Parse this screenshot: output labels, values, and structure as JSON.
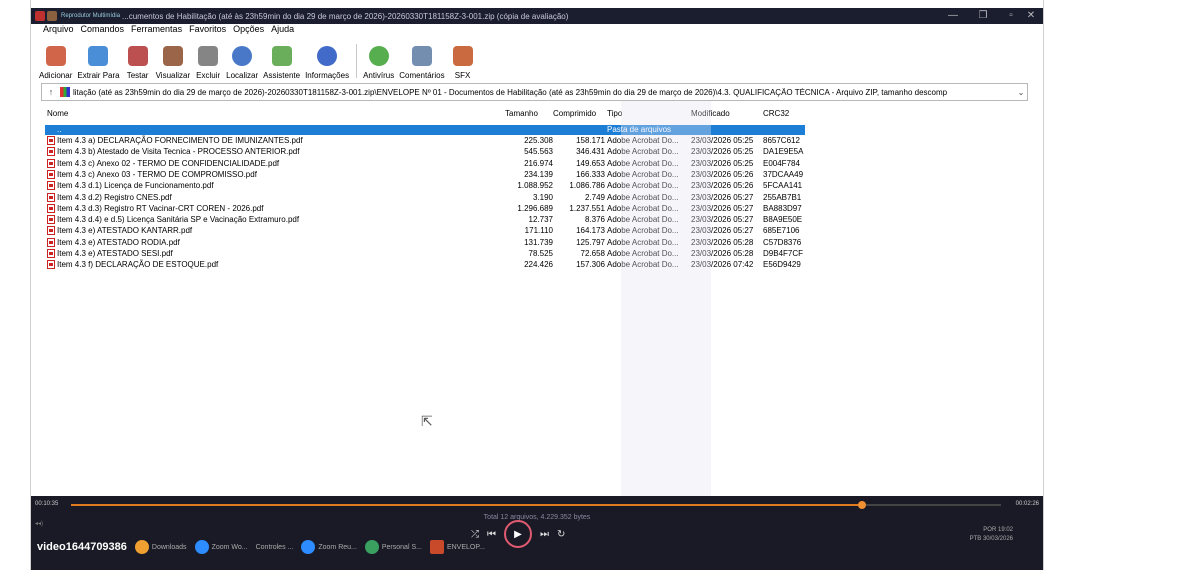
{
  "window": {
    "player_label": "Reprodutor Multimídia",
    "title": "...cumentos de Habilitação (até às 23h59min do dia 29 de março de 2026)-20260330T181158Z-3-001.zip (cópia de avaliação)"
  },
  "menu": [
    "Arquivo",
    "Comandos",
    "Ferramentas",
    "Favoritos",
    "Opções",
    "Ajuda"
  ],
  "toolbar": [
    {
      "label": "Adicionar",
      "icon": "add-archive-icon",
      "color": "#c84a2a"
    },
    {
      "label": "Extrair Para",
      "icon": "extract-icon",
      "color": "#2a7ad0"
    },
    {
      "label": "Testar",
      "icon": "test-icon",
      "color": "#b03030"
    },
    {
      "label": "Visualizar",
      "icon": "view-icon",
      "color": "#8a4a2a"
    },
    {
      "label": "Excluir",
      "icon": "delete-icon",
      "color": "#707070"
    },
    {
      "label": "Localizar",
      "icon": "find-icon",
      "color": "#2a60c0"
    },
    {
      "label": "Assistente",
      "icon": "wizard-icon",
      "color": "#50a040"
    },
    {
      "label": "Informações",
      "icon": "info-icon",
      "color": "#2050c0"
    },
    {
      "label": "Antivírus",
      "icon": "antivirus-icon",
      "color": "#3aa030"
    },
    {
      "label": "Comentários",
      "icon": "comment-icon",
      "color": "#5a7aa0"
    },
    {
      "label": "SFX",
      "icon": "sfx-icon",
      "color": "#c05020"
    }
  ],
  "address": {
    "path": "litação (até as 23h59min do dia 29 de março de 2026)-20260330T181158Z-3-001.zip\\ENVELOPE Nº 01 - Documentos de Habilitação (até as 23h59min do dia 29 de março de 2026)\\4.3. QUALIFICAÇÃO TÉCNICA - Arquivo ZIP, tamanho descomp"
  },
  "columns": {
    "name": "Nome",
    "size": "Tamanho",
    "packed": "Comprimido",
    "type": "Tipo",
    "modified": "Modificado",
    "crc": "CRC32"
  },
  "parent_row": {
    "name": "..",
    "type": "Pasta de arquivos"
  },
  "files": [
    {
      "name": "Item 4.3 a) DECLARAÇÃO FORNECIMENTO DE IMUNIZANTES.pdf",
      "size": "225.308",
      "packed": "158.171",
      "type": "Adobe Acrobat Do...",
      "modified": "23/03/2026 05:25",
      "crc": "8657C612"
    },
    {
      "name": "Item 4.3 b) Atestado de Visita Tecnica - PROCESSO ANTERIOR.pdf",
      "size": "545.563",
      "packed": "346.431",
      "type": "Adobe Acrobat Do...",
      "modified": "23/03/2026 05:25",
      "crc": "DA1E9E5A"
    },
    {
      "name": "Item 4.3 c) Anexo 02 - TERMO DE CONFIDENCIALIDADE.pdf",
      "size": "216.974",
      "packed": "149.653",
      "type": "Adobe Acrobat Do...",
      "modified": "23/03/2026 05:25",
      "crc": "E004F784"
    },
    {
      "name": "Item 4.3 c) Anexo 03 - TERMO DE COMPROMISSO.pdf",
      "size": "234.139",
      "packed": "166.333",
      "type": "Adobe Acrobat Do...",
      "modified": "23/03/2026 05:26",
      "crc": "37DCAA49"
    },
    {
      "name": "Item 4.3 d.1) Licença de Funcionamento.pdf",
      "size": "1.088.952",
      "packed": "1.086.786",
      "type": "Adobe Acrobat Do...",
      "modified": "23/03/2026 05:26",
      "crc": "5FCAA141"
    },
    {
      "name": "Item 4.3 d.2) Registro CNES.pdf",
      "size": "3.190",
      "packed": "2.749",
      "type": "Adobe Acrobat Do...",
      "modified": "23/03/2026 05:27",
      "crc": "255AB7B1"
    },
    {
      "name": "Item 4.3 d.3) Registro RT Vacinar-CRT COREN - 2026.pdf",
      "size": "1.296.689",
      "packed": "1.237.551",
      "type": "Adobe Acrobat Do...",
      "modified": "23/03/2026 05:27",
      "crc": "BA883D97"
    },
    {
      "name": "Item 4.3 d.4) e d.5) Licença Sanitária SP e Vacinação Extramuro.pdf",
      "size": "12.737",
      "packed": "8.376",
      "type": "Adobe Acrobat Do...",
      "modified": "23/03/2026 05:27",
      "crc": "B8A9E50E"
    },
    {
      "name": "Item 4.3 e) ATESTADO KANTARR.pdf",
      "size": "171.110",
      "packed": "164.173",
      "type": "Adobe Acrobat Do...",
      "modified": "23/03/2026 05:27",
      "crc": "685E7106"
    },
    {
      "name": "Item 4.3 e) ATESTADO RODIA.pdf",
      "size": "131.739",
      "packed": "125.797",
      "type": "Adobe Acrobat Do...",
      "modified": "23/03/2026 05:28",
      "crc": "C57D8376"
    },
    {
      "name": "Item 4.3 e) ATESTADO SESI.pdf",
      "size": "78.525",
      "packed": "72.658",
      "type": "Adobe Acrobat Do...",
      "modified": "23/03/2026 05:28",
      "crc": "D9B4F7CF"
    },
    {
      "name": "Item 4.3 f) DECLARAÇÃO DE ESTOQUE.pdf",
      "size": "224.426",
      "packed": "157.306",
      "type": "Adobe Acrobat Do...",
      "modified": "23/03/2026 07:42",
      "crc": "E56D9429"
    }
  ],
  "status": "Total 12 arquivos, 4.229.352 bytes",
  "player": {
    "elapsed": "00:10:35",
    "total": "00:02:26",
    "progress": 0.85
  },
  "taskbar": {
    "video_name": "video1644709386",
    "apps": [
      "Downloads",
      "Zoom Wo...",
      "Controles ...",
      "Zoom Reu...",
      "Personal S...",
      "ENVELOP..."
    ],
    "lang": "POR",
    "lang2": "PTB",
    "time": "19:02",
    "date": "30/03/2026"
  },
  "colors": {
    "selection": "#1d7ed6",
    "accent": "#e07a20",
    "player_bg": "#1a1a26"
  }
}
